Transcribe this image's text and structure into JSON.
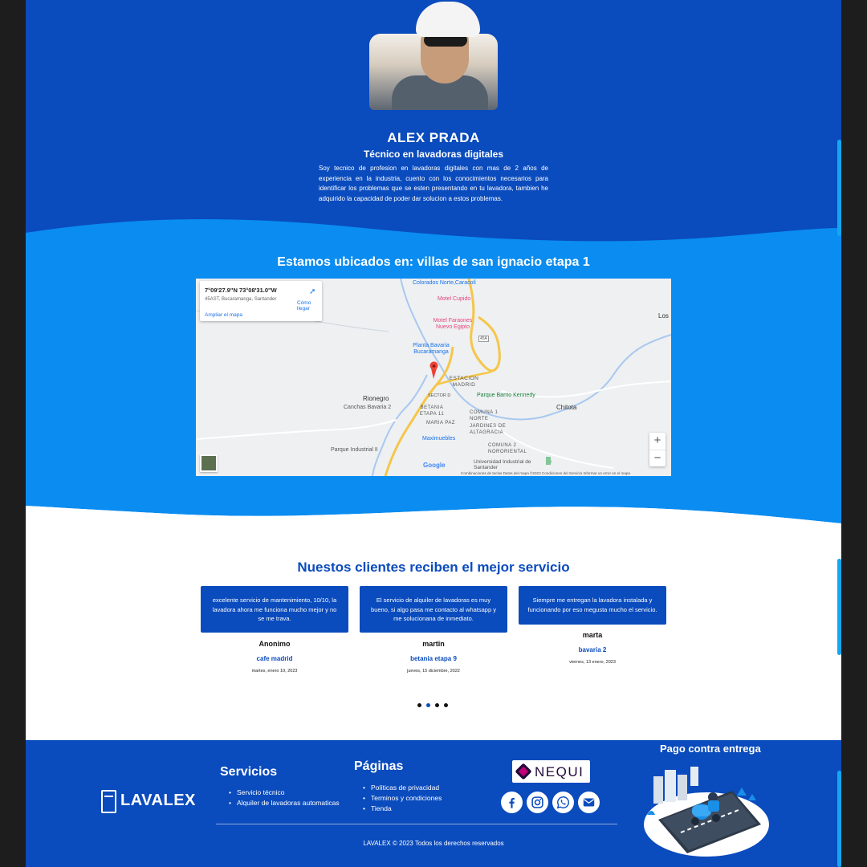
{
  "profile": {
    "name": "ALEX PRADA",
    "role": "Técnico en lavadoras digitales",
    "bio": "Soy tecnico de profesion en lavadoras digitales con mas de 2 años de experiencia en la industria, cuento con los conocimientos necesarios para identificar los problemas que se esten presentando en tu lavadora, tambien he adquirido la capacidad de poder dar solucion a estos problemas."
  },
  "location": {
    "title": "Estamos ubicados en: villas de san ignacio etapa 1",
    "map": {
      "coords": "7°09'27.9\"N 73°08'31.0\"W",
      "address": "45AST, Bucaramanga, Santander",
      "directions_label": "Cómo llegar",
      "enlarge_label": "Ampliar el mapa",
      "zoom_in": "+",
      "zoom_out": "−",
      "footer": "Combinaciones de teclas   Datos del mapa ©2023   Condiciones del Servicio   Informar un error en el mapa",
      "google": "Google",
      "places": [
        "Colorados Norte,Caracolí",
        "Motel Cupido",
        "Motel Faraones Nuevo Egipto",
        "Planta Bavaria Bucaramanga",
        "ESTACION MADRID",
        "SECTOR D",
        "Parque Barrio Kennedy",
        "Rionegro",
        "Canchas Bavaria 2",
        "BETANIA ETAPA 11",
        "COMUNA 1 NORTE",
        "JARDINES DE ALTAGRACIA",
        "MARIA PAZ",
        "Maximuebles",
        "COMUNA 2 NORORIENTAL",
        "Parque Industrial II",
        "Universidad Industrial de Santander",
        "Chitota",
        "Los",
        "45A"
      ]
    }
  },
  "testimonials": {
    "title": "Nuestos clientes reciben el mejor servicio",
    "items": [
      {
        "text": "excelente servicio de mantenimiento, 10/10, la lavadora ahora me funciona mucho mejor y no se me trava.",
        "author": "Anonimo",
        "place": "cafe madrid",
        "date": "martes, enero 10, 2023"
      },
      {
        "text": "El servicio de alquiler de lavadoras es muy bueno, si algo pasa me contacto al whatsapp y me solucionana de inmediato.",
        "author": "martin",
        "place": "betania etapa 9",
        "date": "jueves, 15 diciembre, 2022"
      },
      {
        "text": "Siempre me entregan la lavadora instalada y funcionando por eso megusta mucho el servicio.",
        "author": "marta",
        "place": "bavaria 2",
        "date": "viernes, 13 enero, 2023"
      }
    ],
    "active_dot": 2,
    "dot_count": 4
  },
  "footer": {
    "logo": "LAVALEX",
    "services_title": "Servicios",
    "services": [
      "Servicio técnico",
      "Alquiler de lavadoras automaticas"
    ],
    "pages_title": "Páginas",
    "pages": [
      "Políticas de privacidad",
      "Terminos y condiciones",
      "Tienda"
    ],
    "payment_brand": "NEQUI",
    "social": [
      "facebook-icon",
      "instagram-icon",
      "whatsapp-icon",
      "email-icon"
    ],
    "copyright": "LAVALEX © 2023 Todos los derechos reservados",
    "cod_title": "Pago contra entrega"
  },
  "colors": {
    "dark_blue": "#0a4bbd",
    "light_blue": "#0a8cf0",
    "background": "#1d1d1d"
  }
}
